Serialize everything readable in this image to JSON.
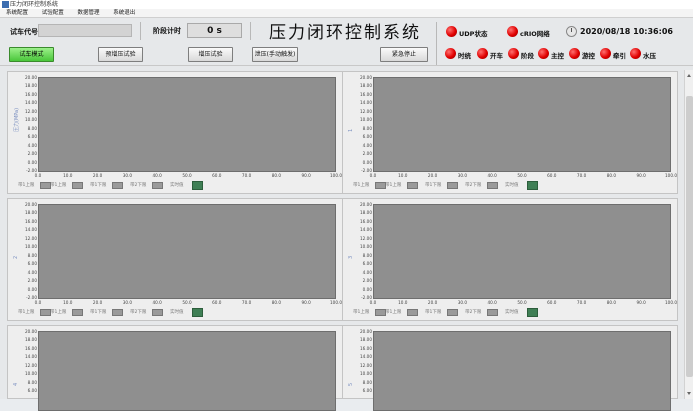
{
  "window": {
    "title": "压力闭环控制系统"
  },
  "menu": [
    "系统配置",
    "试验配置",
    "数据管理",
    "系统退出"
  ],
  "header": {
    "car_code_label": "试车代号",
    "car_code_value": "",
    "phase_timer_label": "阶段计时",
    "phase_timer_value": "0 s",
    "system_title": "压力闭环控制系统",
    "udp_label": "UDP状态",
    "crio_label": "cRIO网络",
    "datetime": "2020/08/18 10:36:06"
  },
  "buttons": {
    "test_mode": "试车模式",
    "pre_pressure": "预增压试验",
    "pressurize": "增压试验",
    "vent": "泄压(手动触发)",
    "emergency_stop": "紧急停止"
  },
  "status_leds": [
    "时统",
    "开车",
    "阶段",
    "主控",
    "游控",
    "牵引",
    "水压"
  ],
  "colors": {
    "led_on": "#e00000",
    "test_mode_button": "#49c63a",
    "plot_bg": "#8f8f8f"
  },
  "panels": [
    {
      "ylabel": "压力(MPa)",
      "legend": [
        "带1上限",
        "带1上限",
        "带1下限",
        "带2下限",
        "实时值"
      ]
    },
    {
      "ylabel": "1",
      "legend": [
        "带1上限",
        "带1上限",
        "带1下限",
        "带2下限",
        "实时值"
      ]
    },
    {
      "ylabel": "2",
      "legend": [
        "带1上限",
        "带1上限",
        "带1下限",
        "带2下限",
        "实时值"
      ]
    },
    {
      "ylabel": "3",
      "legend": [
        "带1上限",
        "带1上限",
        "带1下限",
        "带2下限",
        "实时值"
      ]
    },
    {
      "ylabel": "4",
      "legend": []
    },
    {
      "ylabel": "5",
      "legend": []
    }
  ],
  "chart_axes": {
    "yticks": [
      "20.00",
      "18.00",
      "16.00",
      "14.00",
      "12.00",
      "10.00",
      "8.00",
      "6.00",
      "4.00",
      "2.00",
      "0.00",
      "-2.00"
    ],
    "xticks": [
      "0.0",
      "10.0",
      "20.0",
      "30.0",
      "40.0",
      "50.0",
      "60.0",
      "70.0",
      "80.0",
      "90.0",
      "100.0"
    ]
  }
}
